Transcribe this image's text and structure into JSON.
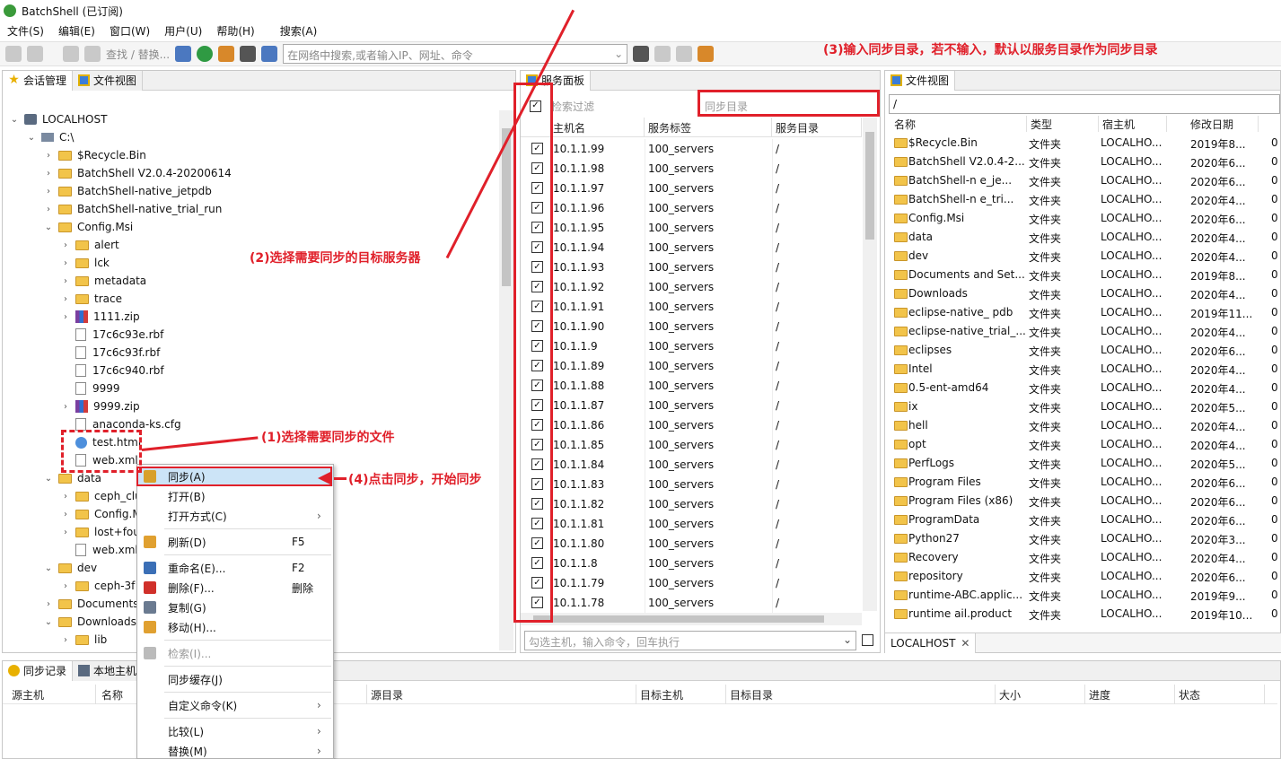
{
  "app": {
    "title": "BatchShell (已订阅)"
  },
  "menu": [
    "文件(S)",
    "编辑(E)",
    "窗口(W)",
    "用户(U)",
    "帮助(H)",
    "搜索(A)"
  ],
  "toolbar": {
    "search_replace": "查找 / 替换...",
    "command_placeholder": "在网络中搜索,或者输入IP、网址、命令"
  },
  "left_panel": {
    "tabs": [
      "会话管理",
      "文件视图"
    ],
    "tree": [
      {
        "label": "LOCALHOST",
        "depth": 0,
        "icon": "computer-icon",
        "toggle": "open"
      },
      {
        "label": "C:\\",
        "depth": 1,
        "icon": "drive-icon",
        "toggle": "open"
      },
      {
        "label": "$Recycle.Bin",
        "depth": 2,
        "icon": "folder-icon",
        "toggle": "closed"
      },
      {
        "label": "BatchShell V2.0.4-20200614",
        "depth": 2,
        "icon": "folder-icon",
        "toggle": "closed"
      },
      {
        "label": "BatchShell-native_jetpdb",
        "depth": 2,
        "icon": "folder-icon",
        "toggle": "closed"
      },
      {
        "label": "BatchShell-native_trial_run",
        "depth": 2,
        "icon": "folder-icon",
        "toggle": "closed"
      },
      {
        "label": "Config.Msi",
        "depth": 2,
        "icon": "folder-icon",
        "toggle": "open"
      },
      {
        "label": "alert",
        "depth": 3,
        "icon": "folder-icon",
        "toggle": "closed"
      },
      {
        "label": "lck",
        "depth": 3,
        "icon": "folder-icon",
        "toggle": "closed"
      },
      {
        "label": "metadata",
        "depth": 3,
        "icon": "folder-icon",
        "toggle": "closed"
      },
      {
        "label": "trace",
        "depth": 3,
        "icon": "folder-icon",
        "toggle": "closed"
      },
      {
        "label": "1111.zip",
        "depth": 3,
        "icon": "zip-icon",
        "toggle": "closed"
      },
      {
        "label": "17c6c93e.rbf",
        "depth": 3,
        "icon": "file-icon",
        "toggle": "none"
      },
      {
        "label": "17c6c93f.rbf",
        "depth": 3,
        "icon": "file-icon",
        "toggle": "none"
      },
      {
        "label": "17c6c940.rbf",
        "depth": 3,
        "icon": "file-icon",
        "toggle": "none"
      },
      {
        "label": "9999",
        "depth": 3,
        "icon": "file-icon",
        "toggle": "none"
      },
      {
        "label": "9999.zip",
        "depth": 3,
        "icon": "zip-icon",
        "toggle": "closed"
      },
      {
        "label": "anaconda-ks.cfg",
        "depth": 3,
        "icon": "file-icon",
        "toggle": "none"
      },
      {
        "label": "test.html",
        "depth": 3,
        "icon": "globe-icon",
        "toggle": "none"
      },
      {
        "label": "web.xml",
        "depth": 3,
        "icon": "file-icon",
        "toggle": "none"
      },
      {
        "label": "data",
        "depth": 2,
        "icon": "folder-icon",
        "toggle": "open"
      },
      {
        "label": "ceph_clu",
        "depth": 3,
        "icon": "folder-icon",
        "toggle": "closed"
      },
      {
        "label": "Config.M",
        "depth": 3,
        "icon": "folder-icon",
        "toggle": "closed"
      },
      {
        "label": "lost+fou",
        "depth": 3,
        "icon": "folder-icon",
        "toggle": "closed"
      },
      {
        "label": "web.xml",
        "depth": 3,
        "icon": "file-icon",
        "toggle": "none"
      },
      {
        "label": "dev",
        "depth": 2,
        "icon": "folder-icon",
        "toggle": "open"
      },
      {
        "label": "ceph-3f",
        "depth": 3,
        "icon": "folder-icon",
        "toggle": "closed"
      },
      {
        "label": "Documents",
        "depth": 2,
        "icon": "folder-icon",
        "toggle": "closed"
      },
      {
        "label": "Downloads",
        "depth": 2,
        "icon": "folder-icon",
        "toggle": "open"
      },
      {
        "label": "lib",
        "depth": 3,
        "icon": "folder-icon",
        "toggle": "closed"
      }
    ]
  },
  "context_menu": [
    {
      "label": "同步(A)",
      "shortcut": "",
      "arrow": false,
      "icon": "sync-icon",
      "highlight": true
    },
    {
      "label": "打开(B)",
      "shortcut": "",
      "arrow": false,
      "icon": ""
    },
    {
      "label": "打开方式(C)",
      "shortcut": "",
      "arrow": true,
      "icon": ""
    },
    {
      "sep": true
    },
    {
      "label": "刷新(D)",
      "shortcut": "F5",
      "arrow": false,
      "icon": "refresh-icon"
    },
    {
      "sep": true
    },
    {
      "label": "重命名(E)...",
      "shortcut": "F2",
      "arrow": false,
      "icon": "rename-icon"
    },
    {
      "label": "删除(F)...",
      "shortcut": "删除",
      "arrow": false,
      "icon": "delete-icon"
    },
    {
      "label": "复制(G)",
      "shortcut": "",
      "arrow": false,
      "icon": "copy-icon"
    },
    {
      "label": "移动(H)...",
      "shortcut": "",
      "arrow": false,
      "icon": "move-icon"
    },
    {
      "sep": true
    },
    {
      "label": "检索(I)...",
      "shortcut": "",
      "arrow": false,
      "icon": "search-icon",
      "disabled": true
    },
    {
      "sep": true
    },
    {
      "label": "同步缓存(J)",
      "shortcut": "",
      "arrow": false,
      "icon": ""
    },
    {
      "sep": true
    },
    {
      "label": "自定义命令(K)",
      "shortcut": "",
      "arrow": true,
      "icon": ""
    },
    {
      "sep": true
    },
    {
      "label": "比较(L)",
      "shortcut": "",
      "arrow": true,
      "icon": ""
    },
    {
      "label": "替换(M)",
      "shortcut": "",
      "arrow": true,
      "icon": ""
    }
  ],
  "service_panel": {
    "tab": "服务面板",
    "filter_placeholder": "检索过滤",
    "sync_dir_placeholder": "同步目录",
    "columns": [
      "主机名",
      "服务标签",
      "服务目录"
    ],
    "rows": [
      [
        "10.1.1.99",
        "100_servers",
        "/"
      ],
      [
        "10.1.1.98",
        "100_servers",
        "/"
      ],
      [
        "10.1.1.97",
        "100_servers",
        "/"
      ],
      [
        "10.1.1.96",
        "100_servers",
        "/"
      ],
      [
        "10.1.1.95",
        "100_servers",
        "/"
      ],
      [
        "10.1.1.94",
        "100_servers",
        "/"
      ],
      [
        "10.1.1.93",
        "100_servers",
        "/"
      ],
      [
        "10.1.1.92",
        "100_servers",
        "/"
      ],
      [
        "10.1.1.91",
        "100_servers",
        "/"
      ],
      [
        "10.1.1.90",
        "100_servers",
        "/"
      ],
      [
        "10.1.1.9",
        "100_servers",
        "/"
      ],
      [
        "10.1.1.89",
        "100_servers",
        "/"
      ],
      [
        "10.1.1.88",
        "100_servers",
        "/"
      ],
      [
        "10.1.1.87",
        "100_servers",
        "/"
      ],
      [
        "10.1.1.86",
        "100_servers",
        "/"
      ],
      [
        "10.1.1.85",
        "100_servers",
        "/"
      ],
      [
        "10.1.1.84",
        "100_servers",
        "/"
      ],
      [
        "10.1.1.83",
        "100_servers",
        "/"
      ],
      [
        "10.1.1.82",
        "100_servers",
        "/"
      ],
      [
        "10.1.1.81",
        "100_servers",
        "/"
      ],
      [
        "10.1.1.80",
        "100_servers",
        "/"
      ],
      [
        "10.1.1.8",
        "100_servers",
        "/"
      ],
      [
        "10.1.1.79",
        "100_servers",
        "/"
      ],
      [
        "10.1.1.78",
        "100_servers",
        "/"
      ]
    ],
    "cmd_placeholder": "勾选主机，输入命令，回车执行"
  },
  "file_view": {
    "tab": "文件视图",
    "path": "/",
    "columns": [
      "名称",
      "类型",
      "宿主机",
      "修改日期"
    ],
    "rows": [
      [
        "$Recycle.Bin",
        "文件夹",
        "LOCALHO...",
        "2019年8...",
        "0"
      ],
      [
        "BatchShell V2.0.4-2...",
        "文件夹",
        "LOCALHO...",
        "2020年6...",
        "0"
      ],
      [
        "BatchShell-n  e_je...",
        "文件夹",
        "LOCALHO...",
        "2020年6...",
        "0"
      ],
      [
        "BatchShell-n  e_tri...",
        "文件夹",
        "LOCALHO...",
        "2020年4...",
        "0"
      ],
      [
        "Config.Msi",
        "文件夹",
        "LOCALHO...",
        "2020年6...",
        "0"
      ],
      [
        "data",
        "文件夹",
        "LOCALHO...",
        "2020年4...",
        "0"
      ],
      [
        "dev",
        "文件夹",
        "LOCALHO...",
        "2020年4...",
        "0"
      ],
      [
        "Documents and Set...",
        "文件夹",
        "LOCALHO...",
        "2019年8...",
        "0"
      ],
      [
        "Downloads",
        "文件夹",
        "LOCALHO...",
        "2020年4...",
        "0"
      ],
      [
        "eclipse-native_  pdb",
        "文件夹",
        "LOCALHO...",
        "2019年11...",
        "0"
      ],
      [
        "eclipse-native_trial_...",
        "文件夹",
        "LOCALHO...",
        "2020年4...",
        "0"
      ],
      [
        "eclipses",
        "文件夹",
        "LOCALHO...",
        "2020年6...",
        "0"
      ],
      [
        "Intel",
        "文件夹",
        "LOCALHO...",
        "2020年4...",
        "0"
      ],
      [
        "  0.5-ent-amd64",
        "文件夹",
        "LOCALHO...",
        "2020年4...",
        "0"
      ],
      [
        "  ix",
        "文件夹",
        "LOCALHO...",
        "2020年5...",
        "0"
      ],
      [
        "  hell",
        "文件夹",
        "LOCALHO...",
        "2020年4...",
        "0"
      ],
      [
        "opt",
        "文件夹",
        "LOCALHO...",
        "2020年4...",
        "0"
      ],
      [
        "PerfLogs",
        "文件夹",
        "LOCALHO...",
        "2020年5...",
        "0"
      ],
      [
        "Program Files",
        "文件夹",
        "LOCALHO...",
        "2020年6...",
        "0"
      ],
      [
        "Program Files (x86)",
        "文件夹",
        "LOCALHO...",
        "2020年6...",
        "0"
      ],
      [
        "ProgramData",
        "文件夹",
        "LOCALHO...",
        "2020年6...",
        "0"
      ],
      [
        "Python27",
        "文件夹",
        "LOCALHO...",
        "2020年3...",
        "0"
      ],
      [
        "Recovery",
        "文件夹",
        "LOCALHO...",
        "2020年4...",
        "0"
      ],
      [
        "repository",
        "文件夹",
        "LOCALHO...",
        "2020年6...",
        "0"
      ],
      [
        "runtime-ABC.applic...",
        "文件夹",
        "LOCALHO...",
        "2019年9...",
        "0"
      ],
      [
        "runtime  ail.product",
        "文件夹",
        "LOCALHO...",
        "2019年10...",
        "0"
      ]
    ],
    "footer_tab": "LOCALHOST"
  },
  "bottom": {
    "tabs": [
      "同步记录",
      "本地主机"
    ],
    "columns": [
      "源主机",
      "名称",
      "源目录",
      "目标主机",
      "目标目录",
      "大小",
      "进度",
      "状态"
    ]
  },
  "annotations": {
    "a1": "(1)选择需要同步的文件",
    "a2": "(2)选择需要同步的目标服务器",
    "a3": "(3)输入同步目录，若不输入，默认以服务目录作为同步目录",
    "a4": "(4)点击同步，开始同步"
  },
  "colors": {
    "annotation": "#e0202a",
    "menu_highlight": "#cce4f7",
    "toolbar_bg": "#f5f5f5"
  }
}
